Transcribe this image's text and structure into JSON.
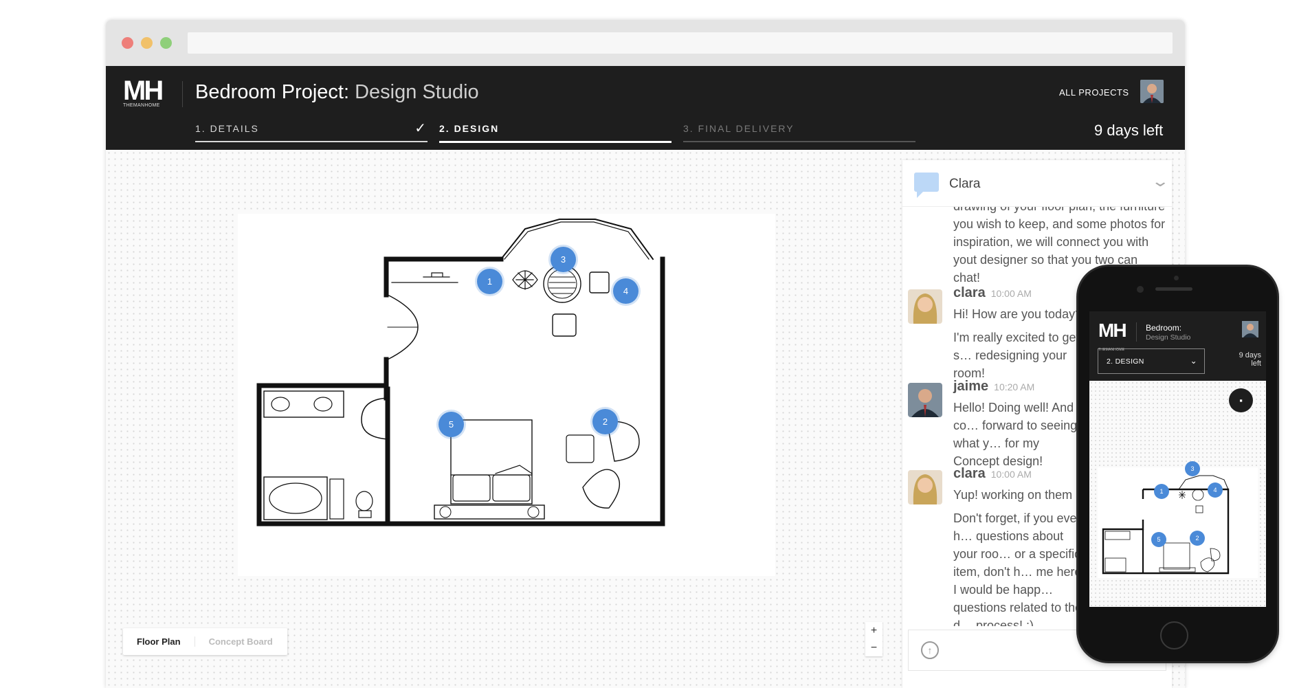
{
  "app": {
    "logo_text": "MH",
    "logo_subtext": "THEMANHOME",
    "title_main": "Bedroom Project:",
    "title_sub": "Design Studio",
    "all_projects": "ALL PROJECTS",
    "days_left": "9 days left"
  },
  "steps": [
    {
      "label": "1. DETAILS",
      "state": "done"
    },
    {
      "label": "2. DESIGN",
      "state": "active"
    },
    {
      "label": "3. FINAL DELIVERY",
      "state": "upcoming"
    }
  ],
  "floorplan": {
    "pins": [
      "1",
      "2",
      "3",
      "4",
      "5"
    ],
    "view_tabs": [
      "Floor Plan",
      "Concept Board"
    ],
    "zoom_in": "+",
    "zoom_out": "−"
  },
  "chat": {
    "contact": "Clara",
    "intro": "drawing of your floor plan, the furniture you wish to keep, and some photos for inspiration, we will connect you with yout designer so that you two can chat!",
    "messages": [
      {
        "author": "clara",
        "time": "10:00 AM",
        "paragraphs": [
          "Hi! How are you today?",
          "I'm really excited to get s… redesigning your room!"
        ]
      },
      {
        "author": "jaime",
        "time": "10:20 AM",
        "paragraphs": [
          "Hello! Doing well! And co… forward to seeing what y… for my Concept design!"
        ]
      },
      {
        "author": "clara",
        "time": "10:00 AM",
        "paragraphs": [
          "Yup! working on them as…",
          "Don't forget, if you ever h… questions about your roo… or a specific item, don't h… me here. I would be happ… questions related to the d… process! :)"
        ]
      }
    ]
  },
  "mobile": {
    "logo_text": "MH",
    "logo_subtext": "THEMANHOME",
    "title": "Bedroom:",
    "subtitle": "Design Studio",
    "step_select": "2. DESIGN",
    "days_left_1": "9 days",
    "days_left_2": "left",
    "pins": [
      "1",
      "2",
      "3",
      "4",
      "5"
    ]
  },
  "colors": {
    "header_bg": "#1e1e1e",
    "pin": "#4a8ad8",
    "chat_bubble": "#bcd8f7"
  }
}
